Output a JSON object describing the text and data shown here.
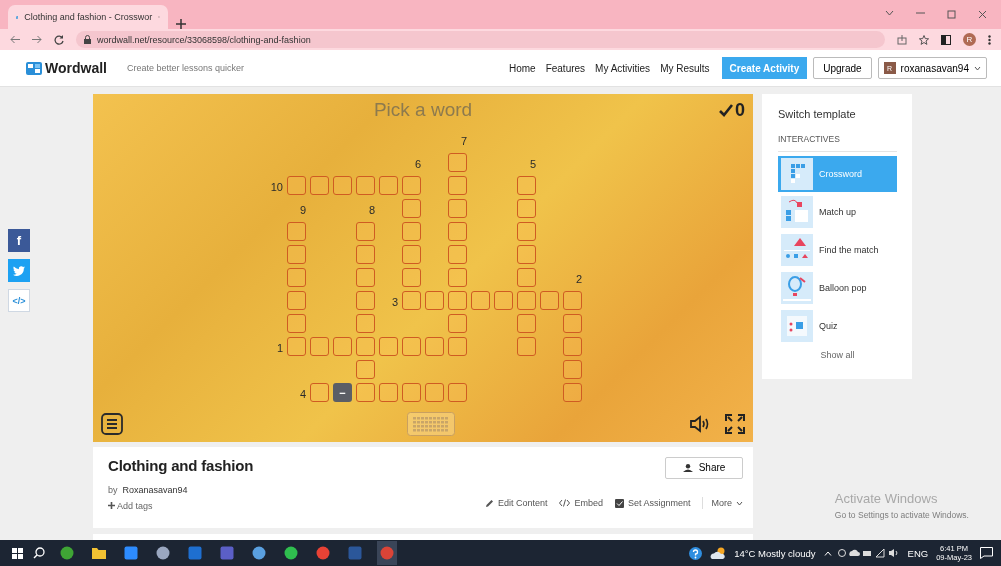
{
  "browser": {
    "tab_title": "Clothing and fashion - Crosswor",
    "url": "wordwall.net/resource/33068598/clothing-and-fashion",
    "profile_initial": "R"
  },
  "header": {
    "logo": "Wordwall",
    "tagline": "Create better lessons quicker",
    "nav": [
      {
        "label": "Home"
      },
      {
        "label": "Features"
      },
      {
        "label": "My Activities"
      },
      {
        "label": "My Results"
      }
    ],
    "create_button": "Create Activity",
    "upgrade_button": "Upgrade",
    "user": {
      "initial": "R",
      "name": "roxanasavan94"
    }
  },
  "social": [
    {
      "kind": "facebook",
      "label": "f"
    },
    {
      "kind": "twitter"
    },
    {
      "kind": "embed",
      "label": "</>"
    }
  ],
  "game": {
    "prompt": "Pick a word",
    "score": "0",
    "grid": [
      {
        "cells": [
          {
            "kind": "gap"
          },
          {
            "kind": "gap"
          },
          {
            "kind": "gap"
          },
          {
            "kind": "gap"
          },
          {
            "kind": "gap"
          },
          {
            "kind": "gap"
          },
          {
            "kind": "gap"
          },
          {
            "kind": "gap"
          },
          {
            "kind": "num",
            "text": "7"
          },
          {
            "kind": "gap"
          },
          {
            "kind": "gap"
          },
          {
            "kind": "gap"
          },
          {
            "kind": "gap"
          },
          {
            "kind": "gap"
          }
        ]
      },
      {
        "cells": [
          {
            "kind": "gap"
          },
          {
            "kind": "gap"
          },
          {
            "kind": "gap"
          },
          {
            "kind": "gap"
          },
          {
            "kind": "gap"
          },
          {
            "kind": "gap"
          },
          {
            "kind": "num",
            "text": "6"
          },
          {
            "kind": "gap"
          },
          {
            "kind": "box"
          },
          {
            "kind": "gap"
          },
          {
            "kind": "gap"
          },
          {
            "kind": "num",
            "text": "5"
          },
          {
            "kind": "gap"
          },
          {
            "kind": "gap"
          }
        ]
      },
      {
        "cells": [
          {
            "kind": "num",
            "text": "10"
          },
          {
            "kind": "box"
          },
          {
            "kind": "box"
          },
          {
            "kind": "box"
          },
          {
            "kind": "box"
          },
          {
            "kind": "box"
          },
          {
            "kind": "box"
          },
          {
            "kind": "gap"
          },
          {
            "kind": "box"
          },
          {
            "kind": "gap"
          },
          {
            "kind": "gap"
          },
          {
            "kind": "box"
          },
          {
            "kind": "gap"
          },
          {
            "kind": "gap"
          }
        ]
      },
      {
        "cells": [
          {
            "kind": "gap"
          },
          {
            "kind": "num",
            "text": "9"
          },
          {
            "kind": "gap"
          },
          {
            "kind": "gap"
          },
          {
            "kind": "num",
            "text": "8"
          },
          {
            "kind": "gap"
          },
          {
            "kind": "box"
          },
          {
            "kind": "gap"
          },
          {
            "kind": "box"
          },
          {
            "kind": "gap"
          },
          {
            "kind": "gap"
          },
          {
            "kind": "box"
          },
          {
            "kind": "gap"
          },
          {
            "kind": "gap"
          }
        ]
      },
      {
        "cells": [
          {
            "kind": "gap"
          },
          {
            "kind": "box"
          },
          {
            "kind": "gap"
          },
          {
            "kind": "gap"
          },
          {
            "kind": "box"
          },
          {
            "kind": "gap"
          },
          {
            "kind": "box"
          },
          {
            "kind": "gap"
          },
          {
            "kind": "box"
          },
          {
            "kind": "gap"
          },
          {
            "kind": "gap"
          },
          {
            "kind": "box"
          },
          {
            "kind": "gap"
          },
          {
            "kind": "gap"
          }
        ]
      },
      {
        "cells": [
          {
            "kind": "gap"
          },
          {
            "kind": "box"
          },
          {
            "kind": "gap"
          },
          {
            "kind": "gap"
          },
          {
            "kind": "box"
          },
          {
            "kind": "gap"
          },
          {
            "kind": "box"
          },
          {
            "kind": "gap"
          },
          {
            "kind": "box"
          },
          {
            "kind": "gap"
          },
          {
            "kind": "gap"
          },
          {
            "kind": "box"
          },
          {
            "kind": "gap"
          },
          {
            "kind": "gap"
          }
        ]
      },
      {
        "cells": [
          {
            "kind": "gap"
          },
          {
            "kind": "box"
          },
          {
            "kind": "gap"
          },
          {
            "kind": "gap"
          },
          {
            "kind": "box"
          },
          {
            "kind": "gap"
          },
          {
            "kind": "box"
          },
          {
            "kind": "gap"
          },
          {
            "kind": "box"
          },
          {
            "kind": "gap"
          },
          {
            "kind": "gap"
          },
          {
            "kind": "box"
          },
          {
            "kind": "gap"
          },
          {
            "kind": "num",
            "text": "2"
          }
        ]
      },
      {
        "cells": [
          {
            "kind": "gap"
          },
          {
            "kind": "box"
          },
          {
            "kind": "gap"
          },
          {
            "kind": "gap"
          },
          {
            "kind": "box"
          },
          {
            "kind": "num",
            "text": "3"
          },
          {
            "kind": "box"
          },
          {
            "kind": "box"
          },
          {
            "kind": "box"
          },
          {
            "kind": "box"
          },
          {
            "kind": "box"
          },
          {
            "kind": "box"
          },
          {
            "kind": "box"
          },
          {
            "kind": "box"
          }
        ]
      },
      {
        "cells": [
          {
            "kind": "gap"
          },
          {
            "kind": "box"
          },
          {
            "kind": "gap"
          },
          {
            "kind": "gap"
          },
          {
            "kind": "box"
          },
          {
            "kind": "gap"
          },
          {
            "kind": "gap"
          },
          {
            "kind": "gap"
          },
          {
            "kind": "box"
          },
          {
            "kind": "gap"
          },
          {
            "kind": "gap"
          },
          {
            "kind": "box"
          },
          {
            "kind": "gap"
          },
          {
            "kind": "box"
          }
        ]
      },
      {
        "cells": [
          {
            "kind": "num",
            "text": "1"
          },
          {
            "kind": "box"
          },
          {
            "kind": "box"
          },
          {
            "kind": "box"
          },
          {
            "kind": "box"
          },
          {
            "kind": "box"
          },
          {
            "kind": "box"
          },
          {
            "kind": "box"
          },
          {
            "kind": "box"
          },
          {
            "kind": "gap"
          },
          {
            "kind": "gap"
          },
          {
            "kind": "box"
          },
          {
            "kind": "gap"
          },
          {
            "kind": "box"
          }
        ]
      },
      {
        "cells": [
          {
            "kind": "gap"
          },
          {
            "kind": "gap"
          },
          {
            "kind": "gap"
          },
          {
            "kind": "gap"
          },
          {
            "kind": "box"
          },
          {
            "kind": "gap"
          },
          {
            "kind": "gap"
          },
          {
            "kind": "gap"
          },
          {
            "kind": "gap"
          },
          {
            "kind": "gap"
          },
          {
            "kind": "gap"
          },
          {
            "kind": "gap"
          },
          {
            "kind": "gap"
          },
          {
            "kind": "box"
          }
        ]
      },
      {
        "cells": [
          {
            "kind": "gap"
          },
          {
            "kind": "num",
            "text": "4"
          },
          {
            "kind": "box"
          },
          {
            "kind": "cursor",
            "text": "−"
          },
          {
            "kind": "box"
          },
          {
            "kind": "box"
          },
          {
            "kind": "box"
          },
          {
            "kind": "box"
          },
          {
            "kind": "box"
          },
          {
            "kind": "gap"
          },
          {
            "kind": "gap"
          },
          {
            "kind": "gap"
          },
          {
            "kind": "gap"
          },
          {
            "kind": "box"
          }
        ]
      }
    ]
  },
  "templates": {
    "title": "Switch template",
    "section": "INTERACTIVES",
    "items": [
      {
        "kind": "crossword",
        "label": "Crossword",
        "selected": true
      },
      {
        "kind": "match-up",
        "label": "Match up",
        "selected": false
      },
      {
        "kind": "find-match",
        "label": "Find the match",
        "selected": false
      },
      {
        "kind": "balloon",
        "label": "Balloon pop",
        "selected": false
      },
      {
        "kind": "quiz",
        "label": "Quiz",
        "selected": false
      }
    ],
    "show_all": "Show all"
  },
  "activity": {
    "title": "Clothing and fashion",
    "by": "by",
    "author": "Roxanasavan94",
    "add_tags": "Add tags",
    "share": "Share",
    "actions": [
      {
        "kind": "edit",
        "label": "Edit Content"
      },
      {
        "kind": "embed",
        "label": "Embed"
      },
      {
        "kind": "assignment",
        "label": "Set Assignment"
      },
      {
        "kind": "more",
        "label": "More"
      }
    ]
  },
  "watermark": {
    "title": "Activate Windows",
    "subtitle": "Go to Settings to activate Windows."
  },
  "taskbar": {
    "apps": [
      {
        "kind": "circle",
        "color": "#3fa535"
      },
      {
        "kind": "folder",
        "color": "#f2c233"
      },
      {
        "kind": "square",
        "color": "#2d8cff"
      },
      {
        "kind": "circle",
        "color": "#9aa7c0"
      },
      {
        "kind": "square",
        "color": "#1e6fd0"
      },
      {
        "kind": "square",
        "color": "#5b5fc7"
      },
      {
        "kind": "circle",
        "color": "#5aa0e0"
      },
      {
        "kind": "circle",
        "color": "#2fbf4f"
      },
      {
        "kind": "circle",
        "color": "#e94235"
      },
      {
        "kind": "square",
        "color": "#2b579a"
      },
      {
        "kind": "circle",
        "color": "#db4437"
      }
    ],
    "weather": "14°C Mostly cloudy",
    "language": "ENG",
    "time": "6:41 PM",
    "date": "09-May-23"
  }
}
